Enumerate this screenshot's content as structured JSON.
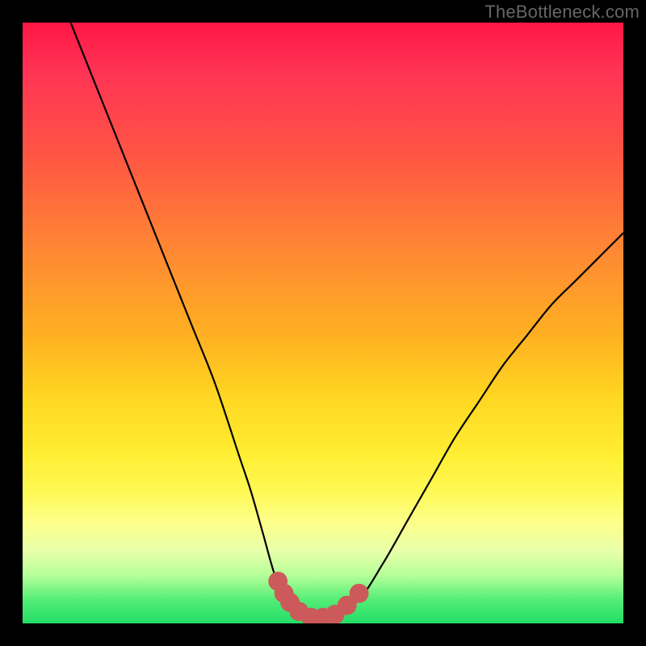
{
  "watermark": {
    "text": "TheBottleneck.com"
  },
  "chart_data": {
    "type": "line",
    "title": "",
    "xlabel": "",
    "ylabel": "",
    "xlim": [
      0,
      100
    ],
    "ylim": [
      0,
      100
    ],
    "series": [
      {
        "name": "main-curve",
        "stroke": "#000000",
        "x": [
          8,
          12,
          16,
          20,
          24,
          28,
          32,
          36,
          38,
          40,
          42,
          44,
          46,
          48,
          50,
          52,
          56,
          60,
          64,
          68,
          72,
          76,
          80,
          84,
          88,
          92,
          96,
          100
        ],
        "y": [
          100,
          90,
          80,
          70,
          60,
          50,
          40,
          28,
          22,
          15,
          8,
          4,
          2,
          1,
          1,
          2,
          4,
          10,
          17,
          24,
          31,
          37,
          43,
          48,
          53,
          57,
          61,
          65
        ]
      },
      {
        "name": "bottom-markers",
        "stroke": "#cc5a5a",
        "marker_r": 1.6,
        "x": [
          42.5,
          43.5,
          44.5,
          46,
          48,
          50,
          52,
          54,
          56
        ],
        "y": [
          7,
          5,
          3.5,
          2,
          1,
          1,
          1.5,
          3,
          5
        ]
      }
    ]
  }
}
